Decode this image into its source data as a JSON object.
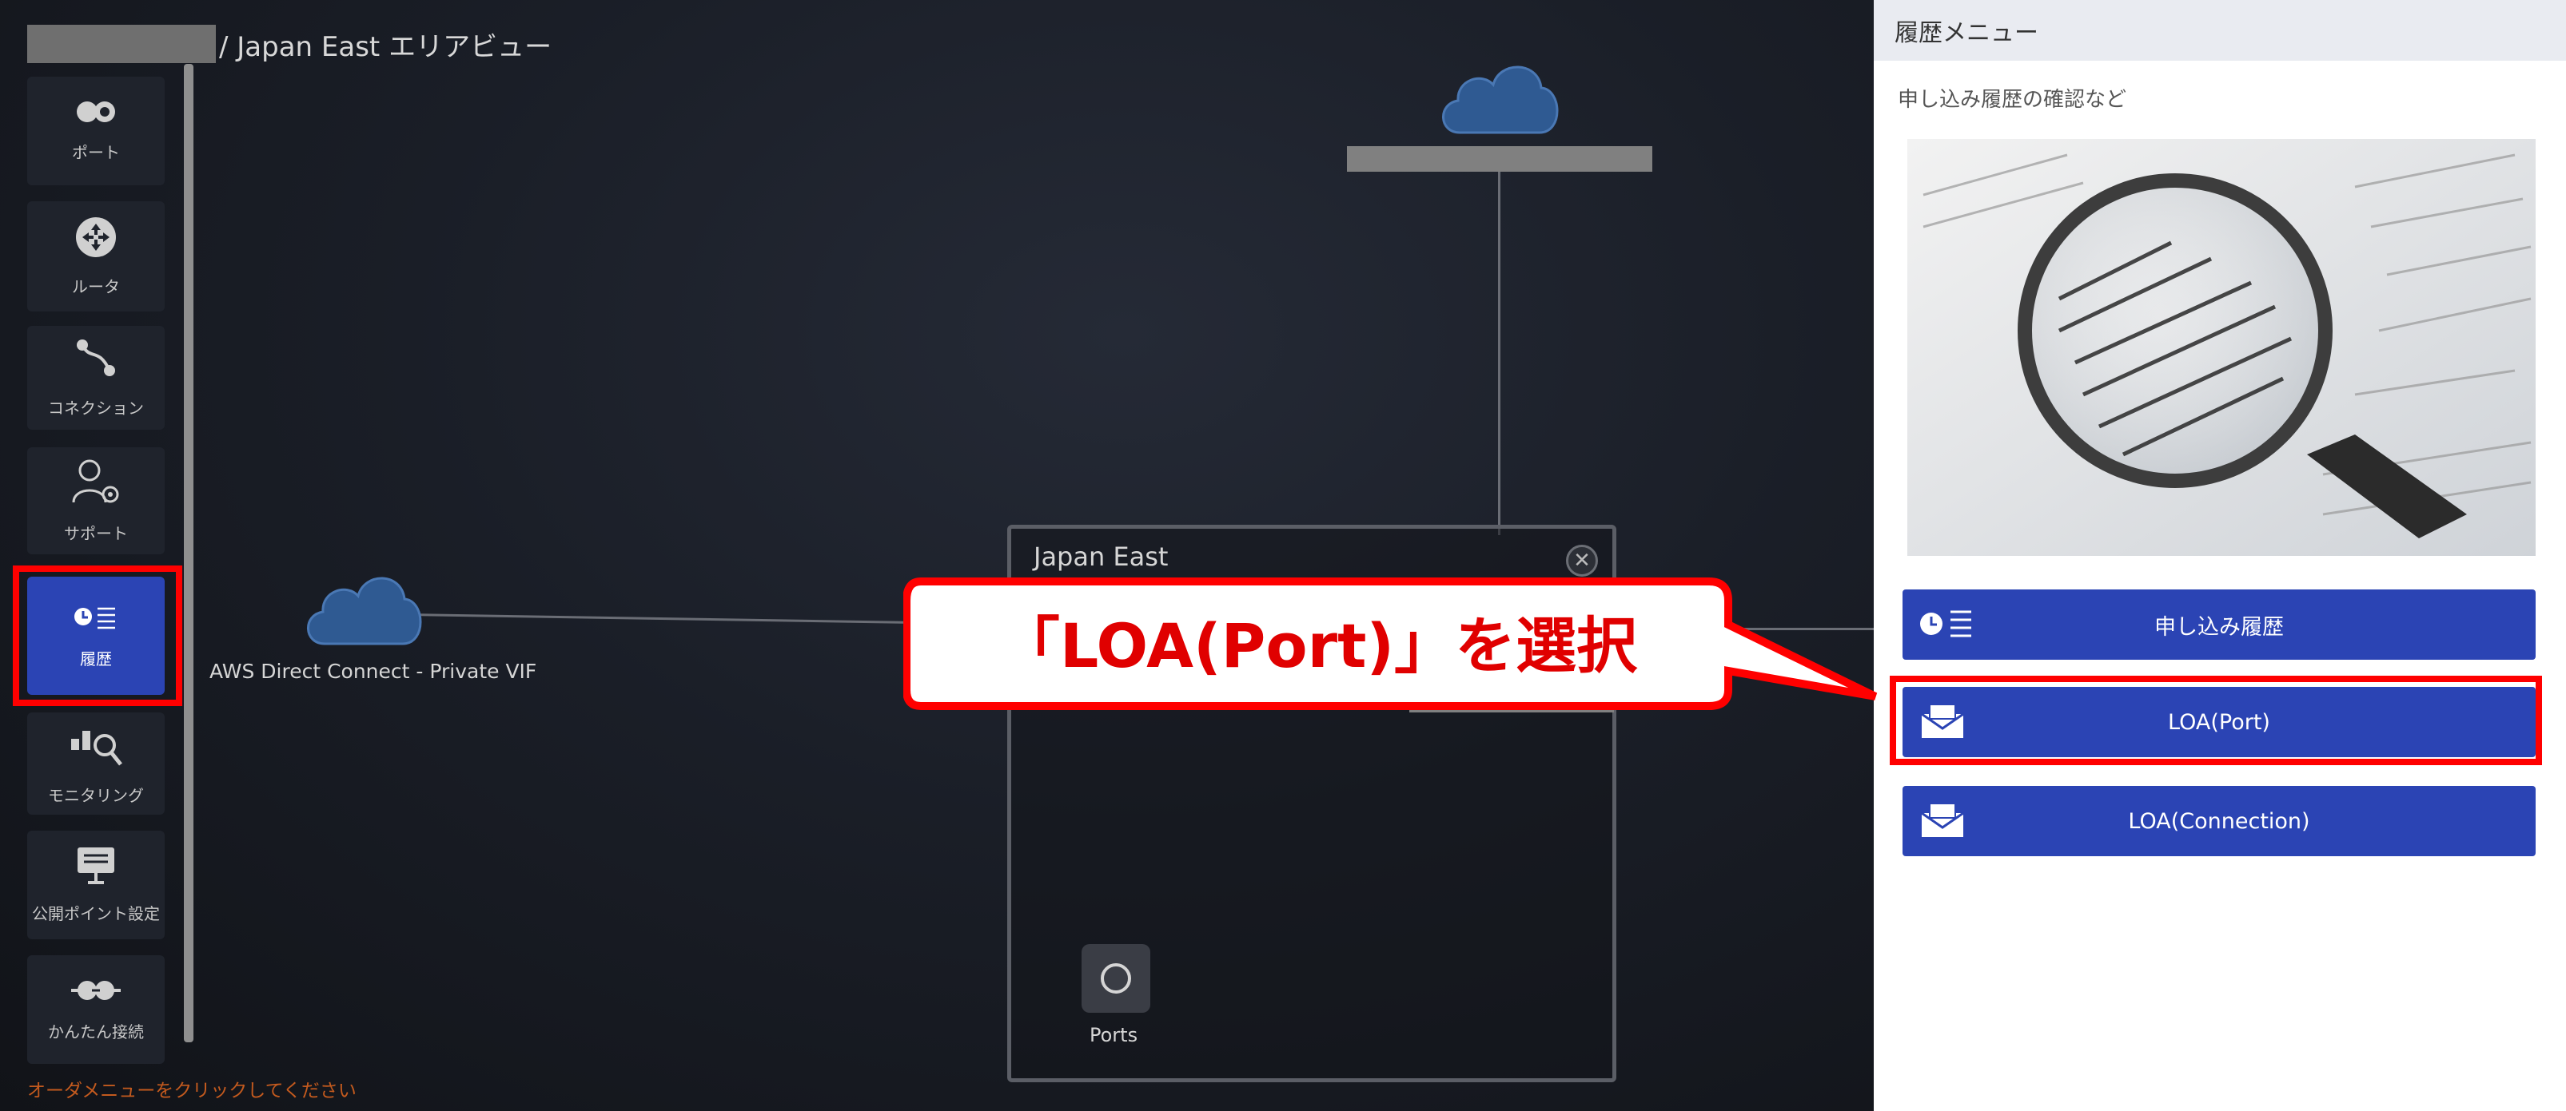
{
  "breadcrumb": {
    "text": "/ Japan East エリアビュー"
  },
  "menu": {
    "items": [
      {
        "label": "ポート",
        "icon": "port-icon"
      },
      {
        "label": "ルータ",
        "icon": "router-icon"
      },
      {
        "label": "コネクション",
        "icon": "connection-icon"
      },
      {
        "label": "サポート",
        "icon": "support-icon"
      },
      {
        "label": "履歴",
        "icon": "history-icon",
        "active": true
      },
      {
        "label": "モニタリング",
        "icon": "monitoring-icon"
      },
      {
        "label": "公開ポイント設定",
        "icon": "public-point-icon"
      },
      {
        "label": "かんたん接続",
        "icon": "easy-connect-icon"
      }
    ],
    "hint": "オーダメニューをクリックしてください"
  },
  "canvas": {
    "aws_label": "AWS Direct Connect - Private VIF",
    "region": {
      "title": "Japan East",
      "ports_label": "Ports"
    }
  },
  "panel": {
    "title": "履歴メニュー",
    "subtitle": "申し込み履歴の確認など",
    "buttons": [
      {
        "label": "申し込み履歴",
        "icon": "history-list-icon"
      },
      {
        "label": "LOA(Port)",
        "icon": "envelope-icon"
      },
      {
        "label": "LOA(Connection)",
        "icon": "envelope-icon"
      }
    ]
  },
  "callout": {
    "text": "「LOA(Port)」を選択"
  },
  "colors": {
    "accent": "#2b44b4",
    "highlight": "#ff0000",
    "hint": "#c35a1e"
  }
}
